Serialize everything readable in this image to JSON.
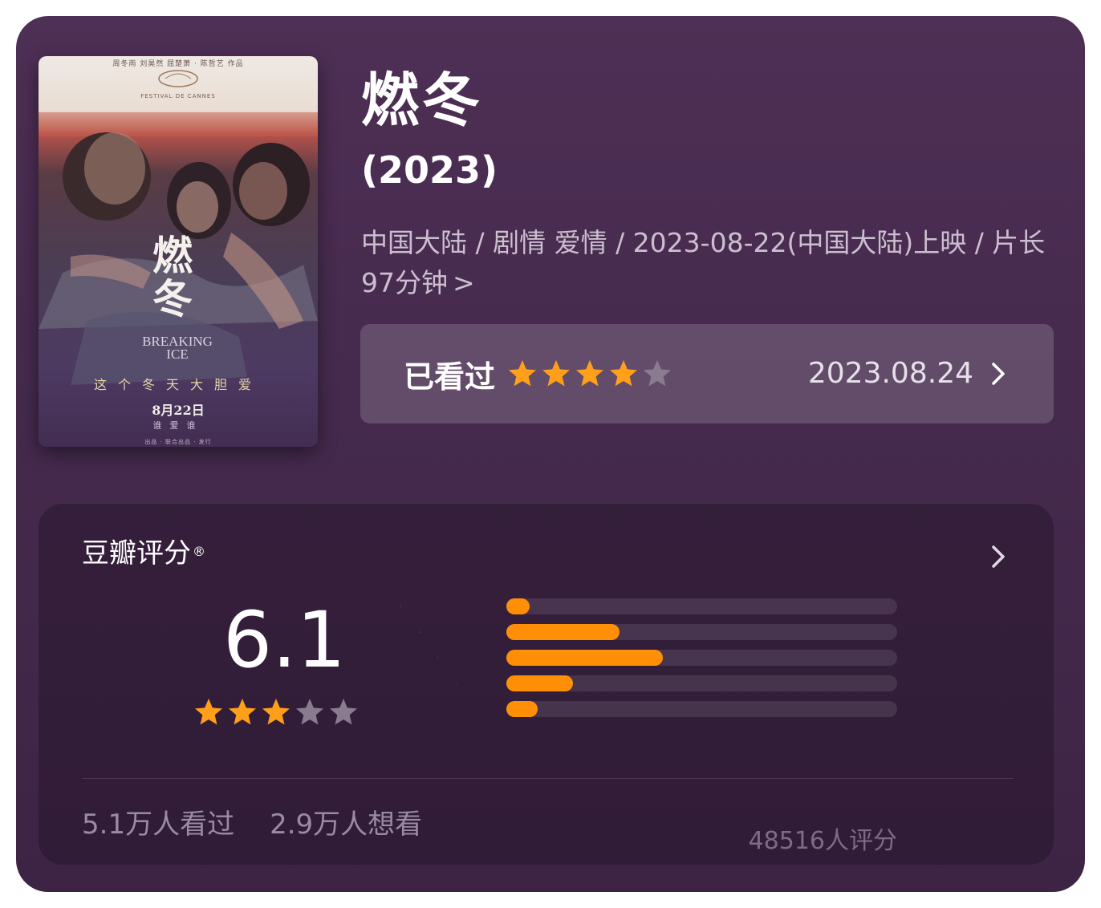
{
  "colors": {
    "accent_star": "#ff9f1a",
    "empty_star": "#8a7b90",
    "bar_fill": "#ff8f07"
  },
  "poster": {
    "credits": "周冬雨 刘昊然 屈楚萧 · 陈哲艺 作品",
    "festival": "FESTIVAL DE CANNES",
    "title_cn": "燃冬",
    "title_en": "BREAKING ICE",
    "tagline": "这个冬天大胆爱",
    "date": "8月22日",
    "sub": "谁爱谁",
    "logos": "出品 · 联合出品 · 发行"
  },
  "movie": {
    "title": "燃冬",
    "year": "(2023)",
    "meta": "中国大陆 / 剧情 爱情 / 2023-08-22(中国大陆)上映 / 片长97分钟",
    "meta_chevron": ">"
  },
  "watched": {
    "label": "已看过",
    "user_rating_stars": 4,
    "max_stars": 5,
    "date": "2023.08.24",
    "chevron_icon": "chevron-right-icon"
  },
  "rating": {
    "title": "豆瓣评分",
    "registered_mark": "®",
    "chevron_icon": "chevron-right-icon",
    "score": "6.1",
    "score_stars": 3,
    "distribution": [
      {
        "stars": 5,
        "fraction": 0.06
      },
      {
        "stars": 4,
        "fraction": 0.29
      },
      {
        "stars": 3,
        "fraction": 0.4
      },
      {
        "stars": 2,
        "fraction": 0.17
      },
      {
        "stars": 1,
        "fraction": 0.08
      }
    ],
    "votes": "48516人评分",
    "watched_count": "5.1万人看过",
    "want_count": "2.9万人想看"
  }
}
